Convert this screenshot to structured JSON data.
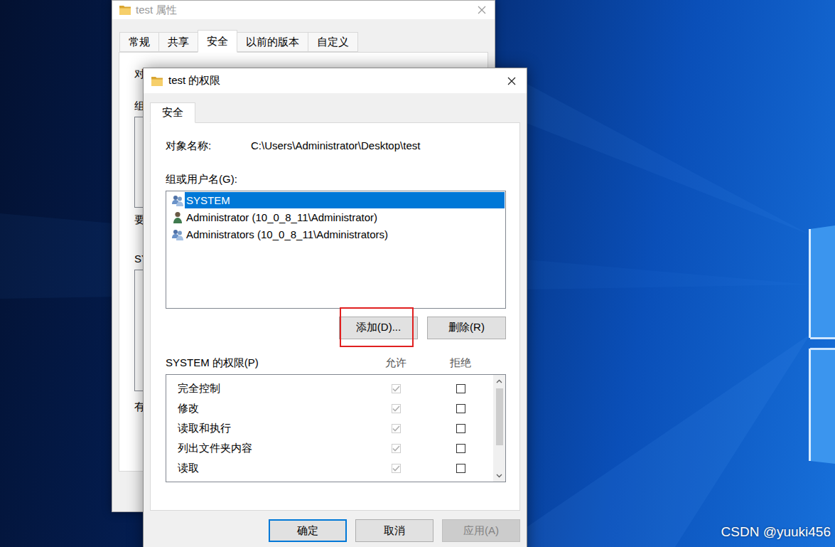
{
  "desktop": {
    "watermark": "CSDN @yuuki456"
  },
  "back_window": {
    "title": "test 属性",
    "tabs": [
      {
        "label": "常规",
        "selected": false
      },
      {
        "label": "共享",
        "selected": false
      },
      {
        "label": "安全",
        "selected": true
      },
      {
        "label": "以前的版本",
        "selected": false
      },
      {
        "label": "自定义",
        "selected": false
      }
    ],
    "clipped_labels": [
      "对",
      "组",
      "要",
      "SY",
      "有"
    ]
  },
  "dialog": {
    "title": "test 的权限",
    "tabs": [
      {
        "label": "安全",
        "selected": true
      }
    ],
    "object_label": "对象名称:",
    "object_path": "C:\\Users\\Administrator\\Desktop\\test",
    "group_label": "组或用户名(G):",
    "principals": [
      {
        "name": "SYSTEM",
        "kind": "group",
        "selected": true
      },
      {
        "name": "Administrator (10_0_8_11\\Administrator)",
        "kind": "user",
        "selected": false
      },
      {
        "name": "Administrators (10_0_8_11\\Administrators)",
        "kind": "group",
        "selected": false
      }
    ],
    "principal_buttons": [
      {
        "label": "添加(D)...",
        "highlighted": true
      },
      {
        "label": "删除(R)",
        "highlighted": false
      }
    ],
    "permissions_label": "SYSTEM 的权限(P)",
    "columns": [
      "允许",
      "拒绝"
    ],
    "permissions": [
      {
        "name": "完全控制",
        "allow": true,
        "deny": false,
        "disabled": true
      },
      {
        "name": "修改",
        "allow": true,
        "deny": false,
        "disabled": true
      },
      {
        "name": "读取和执行",
        "allow": true,
        "deny": false,
        "disabled": true
      },
      {
        "name": "列出文件夹内容",
        "allow": true,
        "deny": false,
        "disabled": true
      },
      {
        "name": "读取",
        "allow": true,
        "deny": false,
        "disabled": true
      }
    ],
    "buttons": [
      {
        "label": "确定",
        "default": true,
        "disabled": false
      },
      {
        "label": "取消",
        "default": false,
        "disabled": false
      },
      {
        "label": "应用(A)",
        "default": false,
        "disabled": true
      }
    ]
  }
}
